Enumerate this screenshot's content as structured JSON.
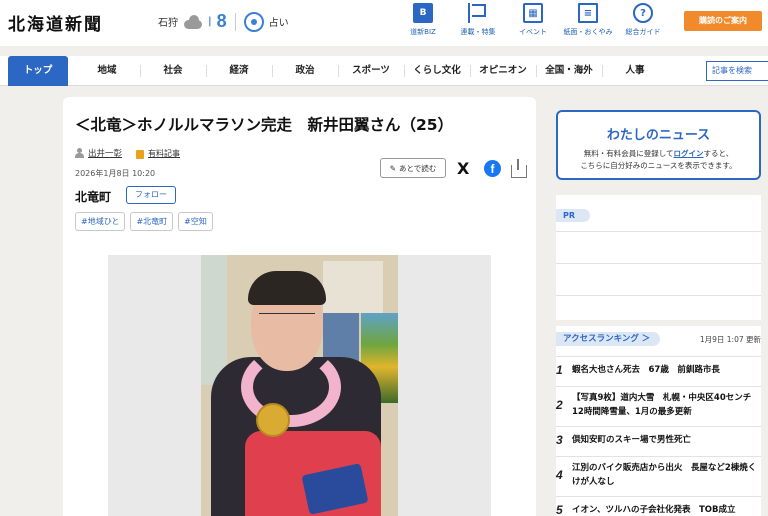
{
  "header": {
    "logo": "北海道新聞",
    "weather_city": "石狩",
    "weather_temp": "8",
    "fortune_label": "占い",
    "nav": [
      {
        "label": "道新BIZ",
        "icon": "biz-icon"
      },
      {
        "label": "連載・特集",
        "icon": "flag-icon"
      },
      {
        "label": "イベント",
        "icon": "calendar-icon"
      },
      {
        "label": "紙面・おくやみ",
        "icon": "newspaper-icon"
      },
      {
        "label": "総合ガイド",
        "icon": "help-icon"
      }
    ],
    "subscribe_label": "購読のご案内"
  },
  "category_nav": {
    "items": [
      "トップ",
      "地域",
      "社会",
      "経済",
      "政治",
      "スポーツ",
      "くらし文化",
      "オピニオン",
      "全国・海外",
      "人事"
    ],
    "active_index": 0,
    "search_label": "記事を検索"
  },
  "article": {
    "title": "＜北竜＞ホノルルマラソン完走　新井田翼さん（25）",
    "author": "出井一彰",
    "paid_label": "有料記事",
    "date": "2026年1月8日 10:20",
    "read_later_label": "あとで読む",
    "x_label": "X",
    "facebook_label": "f",
    "place": "北竜町",
    "follow_label": "フォロー",
    "tags": [
      "#地域ひと",
      "#北竜町",
      "#空知"
    ]
  },
  "sidebar": {
    "mynews_title": "わたしのニュース",
    "mynews_text_1": "無料・有料会員に登録して",
    "mynews_login": "ログイン",
    "mynews_text_2": "すると、",
    "mynews_text_3": "こちらに自分好みのニュースを表示できます。",
    "pr_label": "PR",
    "ranking_title": "アクセスランキング ＞",
    "ranking_time": "1月9日 1:07 更新",
    "ranking": [
      {
        "num": "1",
        "text": "蝦名大也さん死去　67歳　前釧路市長"
      },
      {
        "num": "2",
        "text": "【写真9枚】道内大雪　札幌・中央区40センチ　12時間降雪量、1月の最多更新"
      },
      {
        "num": "3",
        "text": "倶知安町のスキー場で男性死亡"
      },
      {
        "num": "4",
        "text": "江別のバイク販売店から出火　長屋など2棟焼く　けが人なし"
      },
      {
        "num": "5",
        "text": "イオン、ツルハの子会社化発表　TOB成立"
      }
    ]
  }
}
